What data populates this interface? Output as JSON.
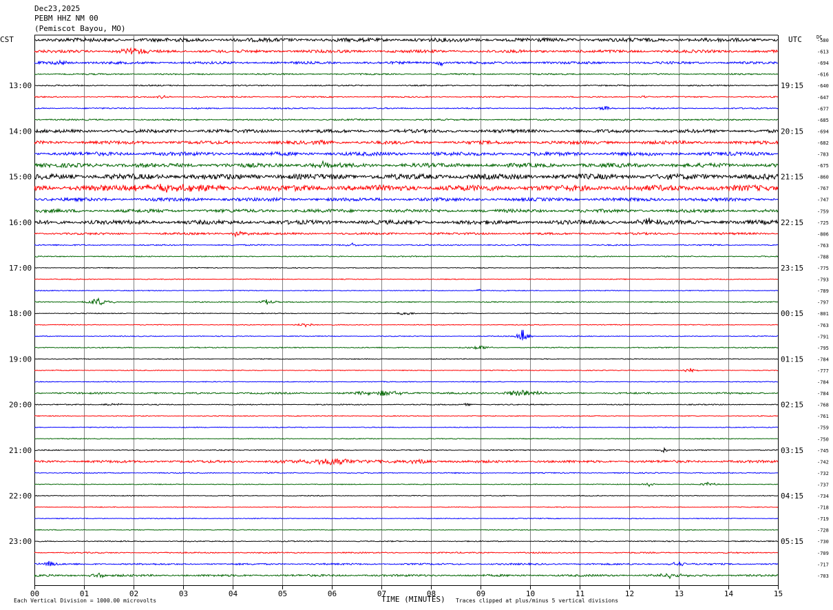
{
  "header": {
    "date": "Dec23,2025",
    "station": "PEBM HHZ NM 00",
    "location": "(Pemiscot Bayou, MO)"
  },
  "left_tz": "CST",
  "right_tz": "UTC",
  "dc_label": "DC",
  "footer": {
    "scale": "Each Vertical Division = 1000.00 microvolts",
    "xlabel": "TIME (MINUTES)",
    "clip": "Traces clipped at plus/minus 5 vertical divisions"
  },
  "colors": {
    "cycle": [
      "#000000",
      "#ff0000",
      "#0000ff",
      "#006400"
    ],
    "grid": "#808080",
    "axis": "#000000"
  },
  "chart_data": {
    "type": "line",
    "xlabel": "TIME (MINUTES)",
    "xlim": [
      0,
      15
    ],
    "x_ticks": [
      "00",
      "01",
      "02",
      "03",
      "04",
      "05",
      "06",
      "07",
      "08",
      "09",
      "10",
      "11",
      "12",
      "13",
      "14",
      "15"
    ],
    "row_minutes": 15,
    "rows_count": 48,
    "left_hour_labels": [
      "13:00",
      "14:00",
      "15:00",
      "16:00",
      "17:00",
      "18:00",
      "19:00",
      "20:00",
      "21:00",
      "22:00",
      "23:00"
    ],
    "right_hour_labels": [
      "19:15",
      "20:15",
      "21:15",
      "22:15",
      "23:15",
      "00:15",
      "01:15",
      "02:15",
      "03:15",
      "04:15",
      "05:15"
    ],
    "hour_label_first_row": 4,
    "dc_offsets": [
      "-580",
      "-613",
      "-694",
      "-616",
      "-640",
      "-647",
      "-677",
      "-685",
      "-694",
      "-682",
      "-783",
      "-675",
      "-860",
      "-767",
      "-747",
      "-759",
      "-725",
      "-806",
      "-763",
      "-788",
      "-775",
      "-793",
      "-789",
      "-797",
      "-801",
      "-763",
      "-791",
      "-795",
      "-784",
      "-777",
      "-784",
      "-784",
      "-768",
      "-761",
      "-759",
      "-750",
      "-745",
      "-742",
      "-732",
      "-737",
      "-734",
      "-718",
      "-719",
      "-728",
      "-730",
      "-709",
      "-717",
      "-703"
    ],
    "noise_levels": [
      0.9,
      0.7,
      0.6,
      0.35,
      0.3,
      0.3,
      0.3,
      0.35,
      0.8,
      0.8,
      0.9,
      1.0,
      1.3,
      1.4,
      0.8,
      0.8,
      1.0,
      0.5,
      0.3,
      0.25,
      0.2,
      0.2,
      0.2,
      0.25,
      0.2,
      0.2,
      0.2,
      0.25,
      0.2,
      0.2,
      0.2,
      0.4,
      0.25,
      0.2,
      0.2,
      0.2,
      0.25,
      0.6,
      0.25,
      0.2,
      0.2,
      0.2,
      0.2,
      0.2,
      0.25,
      0.3,
      0.4,
      0.5
    ],
    "events": [
      {
        "row": 2,
        "minute": 8.2,
        "amp": 7,
        "dur": 0.12
      },
      {
        "row": 2,
        "minute": 0.5,
        "amp": 4,
        "dur": 0.4
      },
      {
        "row": 1,
        "minute": 2.0,
        "amp": 4,
        "dur": 0.6
      },
      {
        "row": 5,
        "minute": 2.6,
        "amp": 3,
        "dur": 0.2
      },
      {
        "row": 5,
        "minute": 12.3,
        "amp": 2,
        "dur": 0.2
      },
      {
        "row": 6,
        "minute": 11.5,
        "amp": 4,
        "dur": 0.25
      },
      {
        "row": 9,
        "minute": 5.9,
        "amp": 5,
        "dur": 0.3
      },
      {
        "row": 11,
        "minute": 5.8,
        "amp": 4,
        "dur": 0.4
      },
      {
        "row": 13,
        "minute": 2.5,
        "amp": 5,
        "dur": 1.5
      },
      {
        "row": 16,
        "minute": 12.4,
        "amp": 6,
        "dur": 0.4
      },
      {
        "row": 17,
        "minute": 4.1,
        "amp": 5,
        "dur": 0.3
      },
      {
        "row": 18,
        "minute": 6.4,
        "amp": 3,
        "dur": 0.2
      },
      {
        "row": 22,
        "minute": 9.0,
        "amp": 3,
        "dur": 0.15
      },
      {
        "row": 23,
        "minute": 1.3,
        "amp": 6,
        "dur": 0.4
      },
      {
        "row": 23,
        "minute": 4.7,
        "amp": 4,
        "dur": 0.3
      },
      {
        "row": 24,
        "minute": 7.5,
        "amp": 3,
        "dur": 0.3
      },
      {
        "row": 25,
        "minute": 5.5,
        "amp": 4,
        "dur": 0.3
      },
      {
        "row": 26,
        "minute": 9.85,
        "amp": 11,
        "dur": 0.2
      },
      {
        "row": 27,
        "minute": 9.0,
        "amp": 3,
        "dur": 0.5
      },
      {
        "row": 29,
        "minute": 13.2,
        "amp": 4,
        "dur": 0.2
      },
      {
        "row": 31,
        "minute": 9.8,
        "amp": 5,
        "dur": 0.8
      },
      {
        "row": 31,
        "minute": 7.0,
        "amp": 4,
        "dur": 1.0
      },
      {
        "row": 32,
        "minute": 1.6,
        "amp": 3,
        "dur": 0.3
      },
      {
        "row": 32,
        "minute": 8.7,
        "amp": 3,
        "dur": 0.2
      },
      {
        "row": 36,
        "minute": 12.7,
        "amp": 4,
        "dur": 0.2
      },
      {
        "row": 37,
        "minute": 6.0,
        "amp": 5,
        "dur": 1.5
      },
      {
        "row": 37,
        "minute": 7.8,
        "amp": 4,
        "dur": 0.4
      },
      {
        "row": 39,
        "minute": 12.4,
        "amp": 3,
        "dur": 0.2
      },
      {
        "row": 39,
        "minute": 13.6,
        "amp": 4,
        "dur": 0.2
      },
      {
        "row": 46,
        "minute": 0.3,
        "amp": 4,
        "dur": 0.3
      },
      {
        "row": 46,
        "minute": 13.0,
        "amp": 4,
        "dur": 0.3
      },
      {
        "row": 47,
        "minute": 1.3,
        "amp": 4,
        "dur": 0.3
      },
      {
        "row": 47,
        "minute": 12.8,
        "amp": 4,
        "dur": 0.4
      }
    ]
  }
}
